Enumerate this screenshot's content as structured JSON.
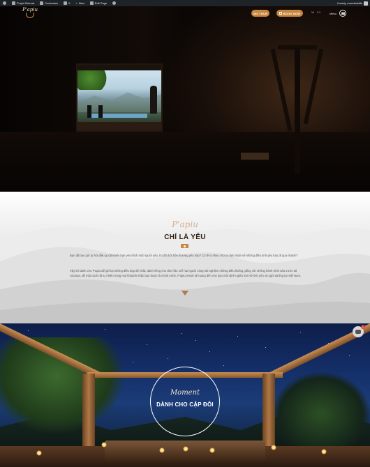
{
  "adminbar": {
    "site_name": "P'apiu Retreat",
    "customize": "Customize",
    "comments": "0",
    "new": "New",
    "edit_page": "Edit Page",
    "greeting": "Howdy, mountainlife"
  },
  "header": {
    "logo_text": "P'apiu",
    "btn_360": "360 TOUR",
    "btn_book": "BOOK NOW",
    "lang_vi": "VI",
    "lang_en": "EN",
    "menu_label": "Menu"
  },
  "intro": {
    "script": "P'apiu",
    "title": "CHỈ LÀ YÊU",
    "para1": "Bạn đã bao giờ tự hỏi điều gì đã khiến bạn yêu thích một người yêu, họ đã thổi hồn thương yêu nào? Có lẽ vì nhau cho ta cảm nhận về những điều tình yêu trao đi qua nhanh?",
    "para2": "Vậy thì dành cho P'apiu để giữ lại những điều đẹp đẽ nhất, dành riêng cho tâm hồn. Để hai người cùng trải nghiệm những điều không giống với những hành trình nào trước đó của bạn, để một cách rất tự nhiên trong mọi khoảnh khắc bạn được là chính mình. P'apiu resort sẽ mang đến cho bạn một định nghĩa mới về tình yêu và nghỉ dưỡng tại Việt Nam."
  },
  "moment": {
    "script": "Moment",
    "title": "DÀNH CHO CẶP ĐÔI"
  },
  "chat": {
    "badge": "1"
  },
  "colors": {
    "accent": "#c8863f",
    "admin_bar": "#1d2327",
    "title_brown": "#2f1e10"
  },
  "icons": {
    "menu": "hamburger-icon",
    "book": "calendar-icon",
    "chat": "chat-icon",
    "arrow": "triangle-down-icon"
  }
}
